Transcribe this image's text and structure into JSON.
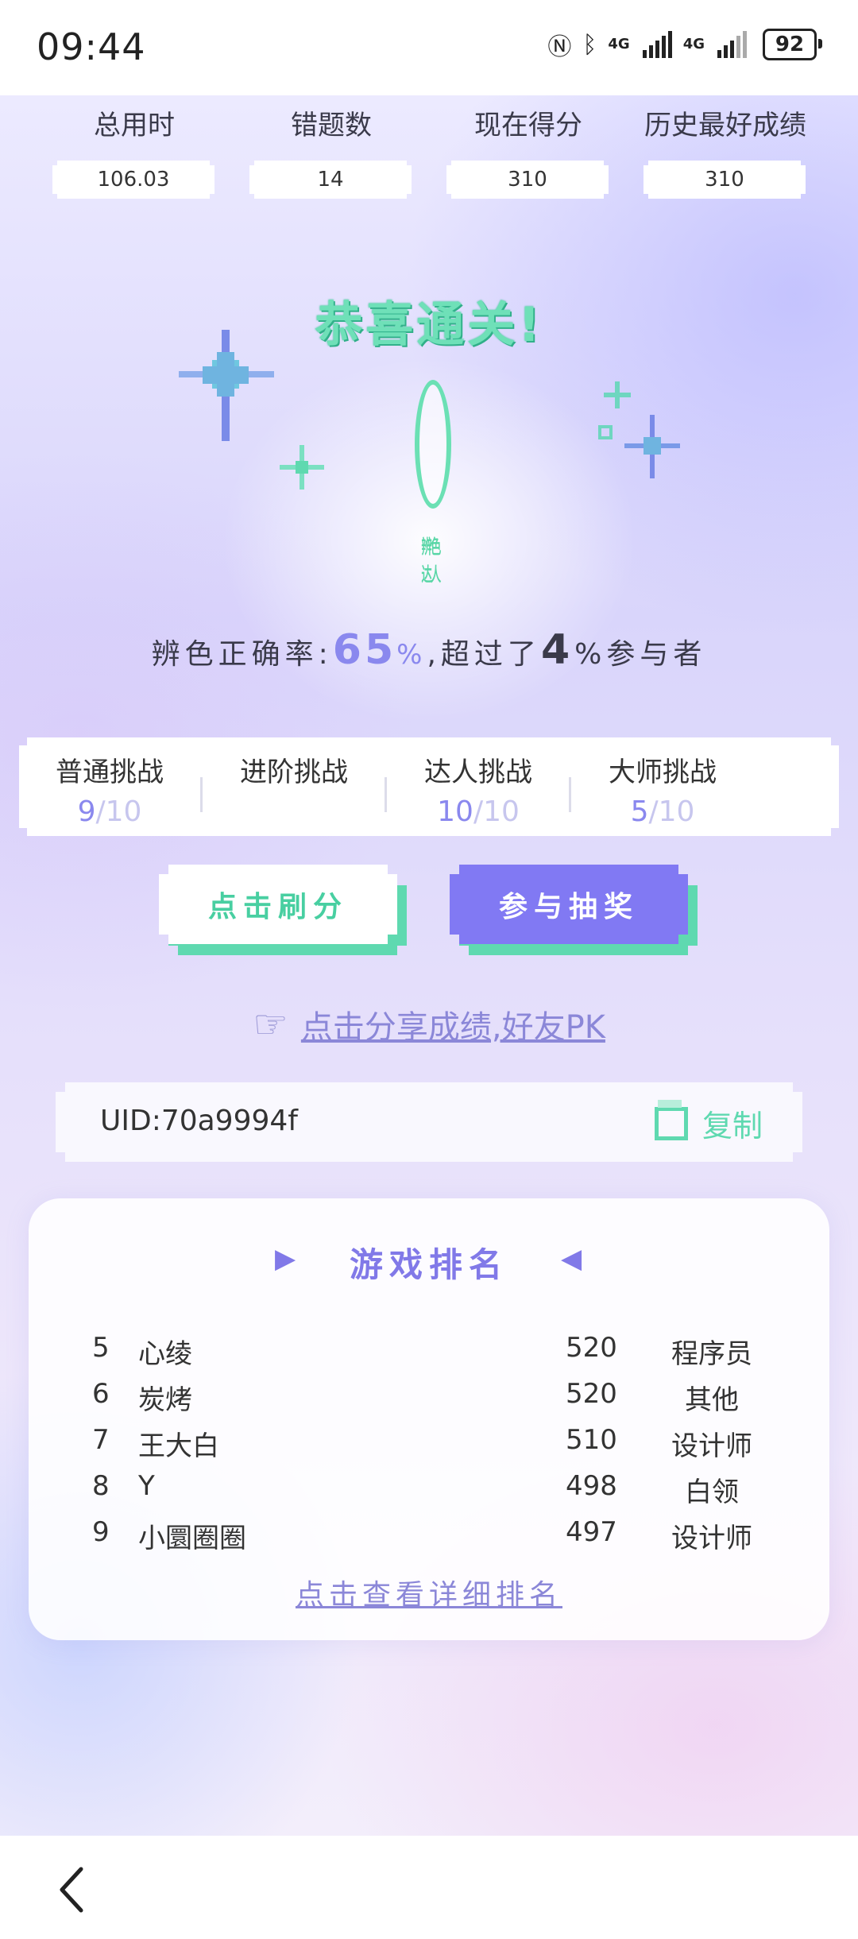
{
  "status_bar": {
    "time": "09:44",
    "battery": "92",
    "network_1": "4G",
    "network_2": "4G"
  },
  "stats": [
    {
      "label": "总用时",
      "value": "106.03"
    },
    {
      "label": "错题数",
      "value": "14"
    },
    {
      "label": "现在得分",
      "value": "310"
    },
    {
      "label": "历史最好成绩",
      "value": "310"
    }
  ],
  "result": {
    "title": "恭喜通关!",
    "badge_label": "辨色达人",
    "accuracy_prefix": "辨色正确率:",
    "accuracy_value": "65",
    "accuracy_pct": "%",
    "surpass_prefix": ",超过了",
    "surpass_value": "4",
    "surpass_suffix": "%参与者"
  },
  "challenges": [
    {
      "title": "普通挑战",
      "score": "9",
      "total": "/10"
    },
    {
      "title": "进阶挑战",
      "score": "",
      "total": ""
    },
    {
      "title": "达人挑战",
      "score": "10",
      "total": "/10"
    },
    {
      "title": "大师挑战",
      "score": "5",
      "total": "/10"
    }
  ],
  "buttons": {
    "score": "点击刷分",
    "lottery": "参与抽奖"
  },
  "share": {
    "label": "点击分享成绩,好友PK",
    "icon": "pointing-hand-icon"
  },
  "uid": {
    "text": "UID:70a9994f",
    "copy_label": "复制"
  },
  "ranking": {
    "title": "游戏排名",
    "rows": [
      {
        "rank": "5",
        "name": "心绫",
        "score": "520",
        "job": "程序员"
      },
      {
        "rank": "6",
        "name": "炭烤",
        "score": "520",
        "job": "其他"
      },
      {
        "rank": "7",
        "name": "王大白",
        "score": "510",
        "job": "设计师"
      },
      {
        "rank": "8",
        "name": "Y",
        "score": "498",
        "job": "白领"
      },
      {
        "rank": "9",
        "name": "小圜圈圈",
        "score": "497",
        "job": "设计师"
      }
    ],
    "more_link": "点击查看详细排名"
  },
  "colors": {
    "accent_green": "#5fd9b0",
    "accent_purple": "#8179f3",
    "link": "#8b87d8"
  }
}
